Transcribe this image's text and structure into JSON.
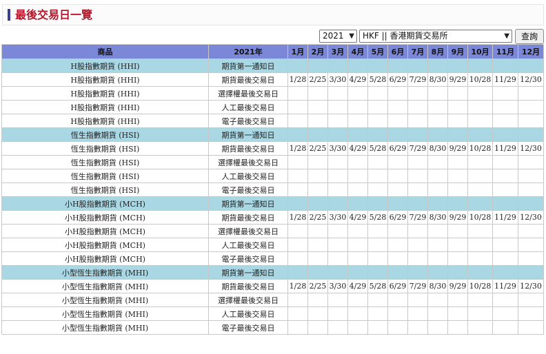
{
  "page": {
    "title": "最後交易日一覽",
    "year_select": "2021",
    "exchange_select": "HKF || 香港期貨交易所",
    "query_button": "查詢"
  },
  "table": {
    "headers": [
      "商品",
      "2021年",
      "1月",
      "2月",
      "3月",
      "4月",
      "5月",
      "6月",
      "7月",
      "8月",
      "9月",
      "10月",
      "11月",
      "12月"
    ],
    "types": [
      "期貨第一通知日",
      "期貨最後交易日",
      "選擇權最後交易日",
      "人工最後交易日",
      "電子最後交易日"
    ],
    "products": [
      {
        "name": "H股指數期貨 (HHI)",
        "dates": [
          "1/28",
          "2/25",
          "3/30",
          "4/29",
          "5/28",
          "6/29",
          "7/29",
          "8/30",
          "9/29",
          "10/28",
          "11/29",
          "12/30"
        ]
      },
      {
        "name": "恆生指數期貨 (HSI)",
        "dates": [
          "1/28",
          "2/25",
          "3/30",
          "4/29",
          "5/28",
          "6/29",
          "7/29",
          "8/30",
          "9/29",
          "10/28",
          "11/29",
          "12/30"
        ]
      },
      {
        "name": "小H股指數期貨 (MCH)",
        "dates": [
          "1/28",
          "2/25",
          "3/30",
          "4/29",
          "5/28",
          "6/29",
          "7/29",
          "8/30",
          "9/29",
          "10/28",
          "11/29",
          "12/30"
        ]
      },
      {
        "name": "小型恆生指數期貨 (MHI)",
        "dates": [
          "1/28",
          "2/25",
          "3/30",
          "4/29",
          "5/28",
          "6/29",
          "7/29",
          "8/30",
          "9/29",
          "10/28",
          "11/29",
          "12/30"
        ]
      }
    ]
  },
  "colors": {
    "title_red": "#b2172b",
    "header_blue": "#7b88d8",
    "first_row_cyan": "#a9d7e3"
  }
}
